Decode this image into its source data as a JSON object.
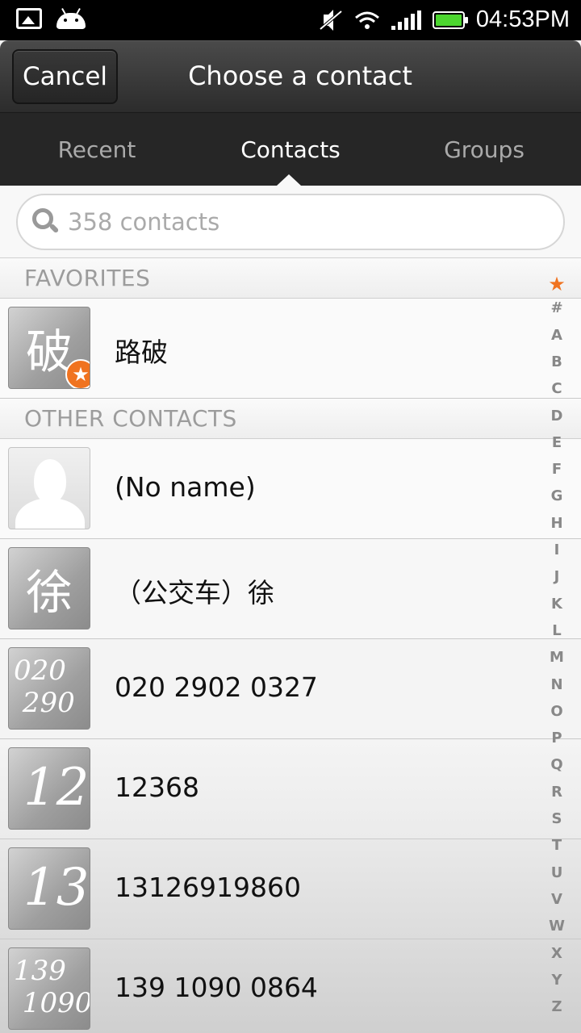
{
  "status_bar": {
    "time": "04:53PM",
    "icons": [
      "gallery-icon",
      "android-debug-icon",
      "mute-icon",
      "wifi-icon",
      "signal-icon",
      "battery-icon"
    ]
  },
  "action_bar": {
    "cancel_label": "Cancel",
    "title": "Choose a contact"
  },
  "tabs": [
    {
      "label": "Recent",
      "active": false
    },
    {
      "label": "Contacts",
      "active": true
    },
    {
      "label": "Groups",
      "active": false
    }
  ],
  "search": {
    "placeholder": "358 contacts"
  },
  "sections": {
    "favorites": "FAVORITES",
    "other": "OTHER CONTACTS"
  },
  "favorites": [
    {
      "name": "路破",
      "avatar_text": "破"
    }
  ],
  "contacts": [
    {
      "name": "(No name)",
      "avatar_type": "placeholder"
    },
    {
      "name": "（公交车）徐",
      "avatar_text": "徐"
    },
    {
      "name": "020 2902 0327",
      "avatar_scrawl": "020\n 290"
    },
    {
      "name": "12368",
      "avatar_scrawl": "12"
    },
    {
      "name": "13126919860",
      "avatar_scrawl": "13"
    },
    {
      "name": "139 1090 0864",
      "avatar_scrawl": "139\n 1090"
    }
  ],
  "alpha_index": [
    "★",
    "#",
    "A",
    "B",
    "C",
    "D",
    "E",
    "F",
    "G",
    "H",
    "I",
    "J",
    "K",
    "L",
    "M",
    "N",
    "O",
    "P",
    "Q",
    "R",
    "S",
    "T",
    "U",
    "V",
    "W",
    "X",
    "Y",
    "Z"
  ],
  "colors": {
    "accent_orange": "#f07320",
    "battery_green": "#4cd62f",
    "tab_bar": "#262626"
  }
}
